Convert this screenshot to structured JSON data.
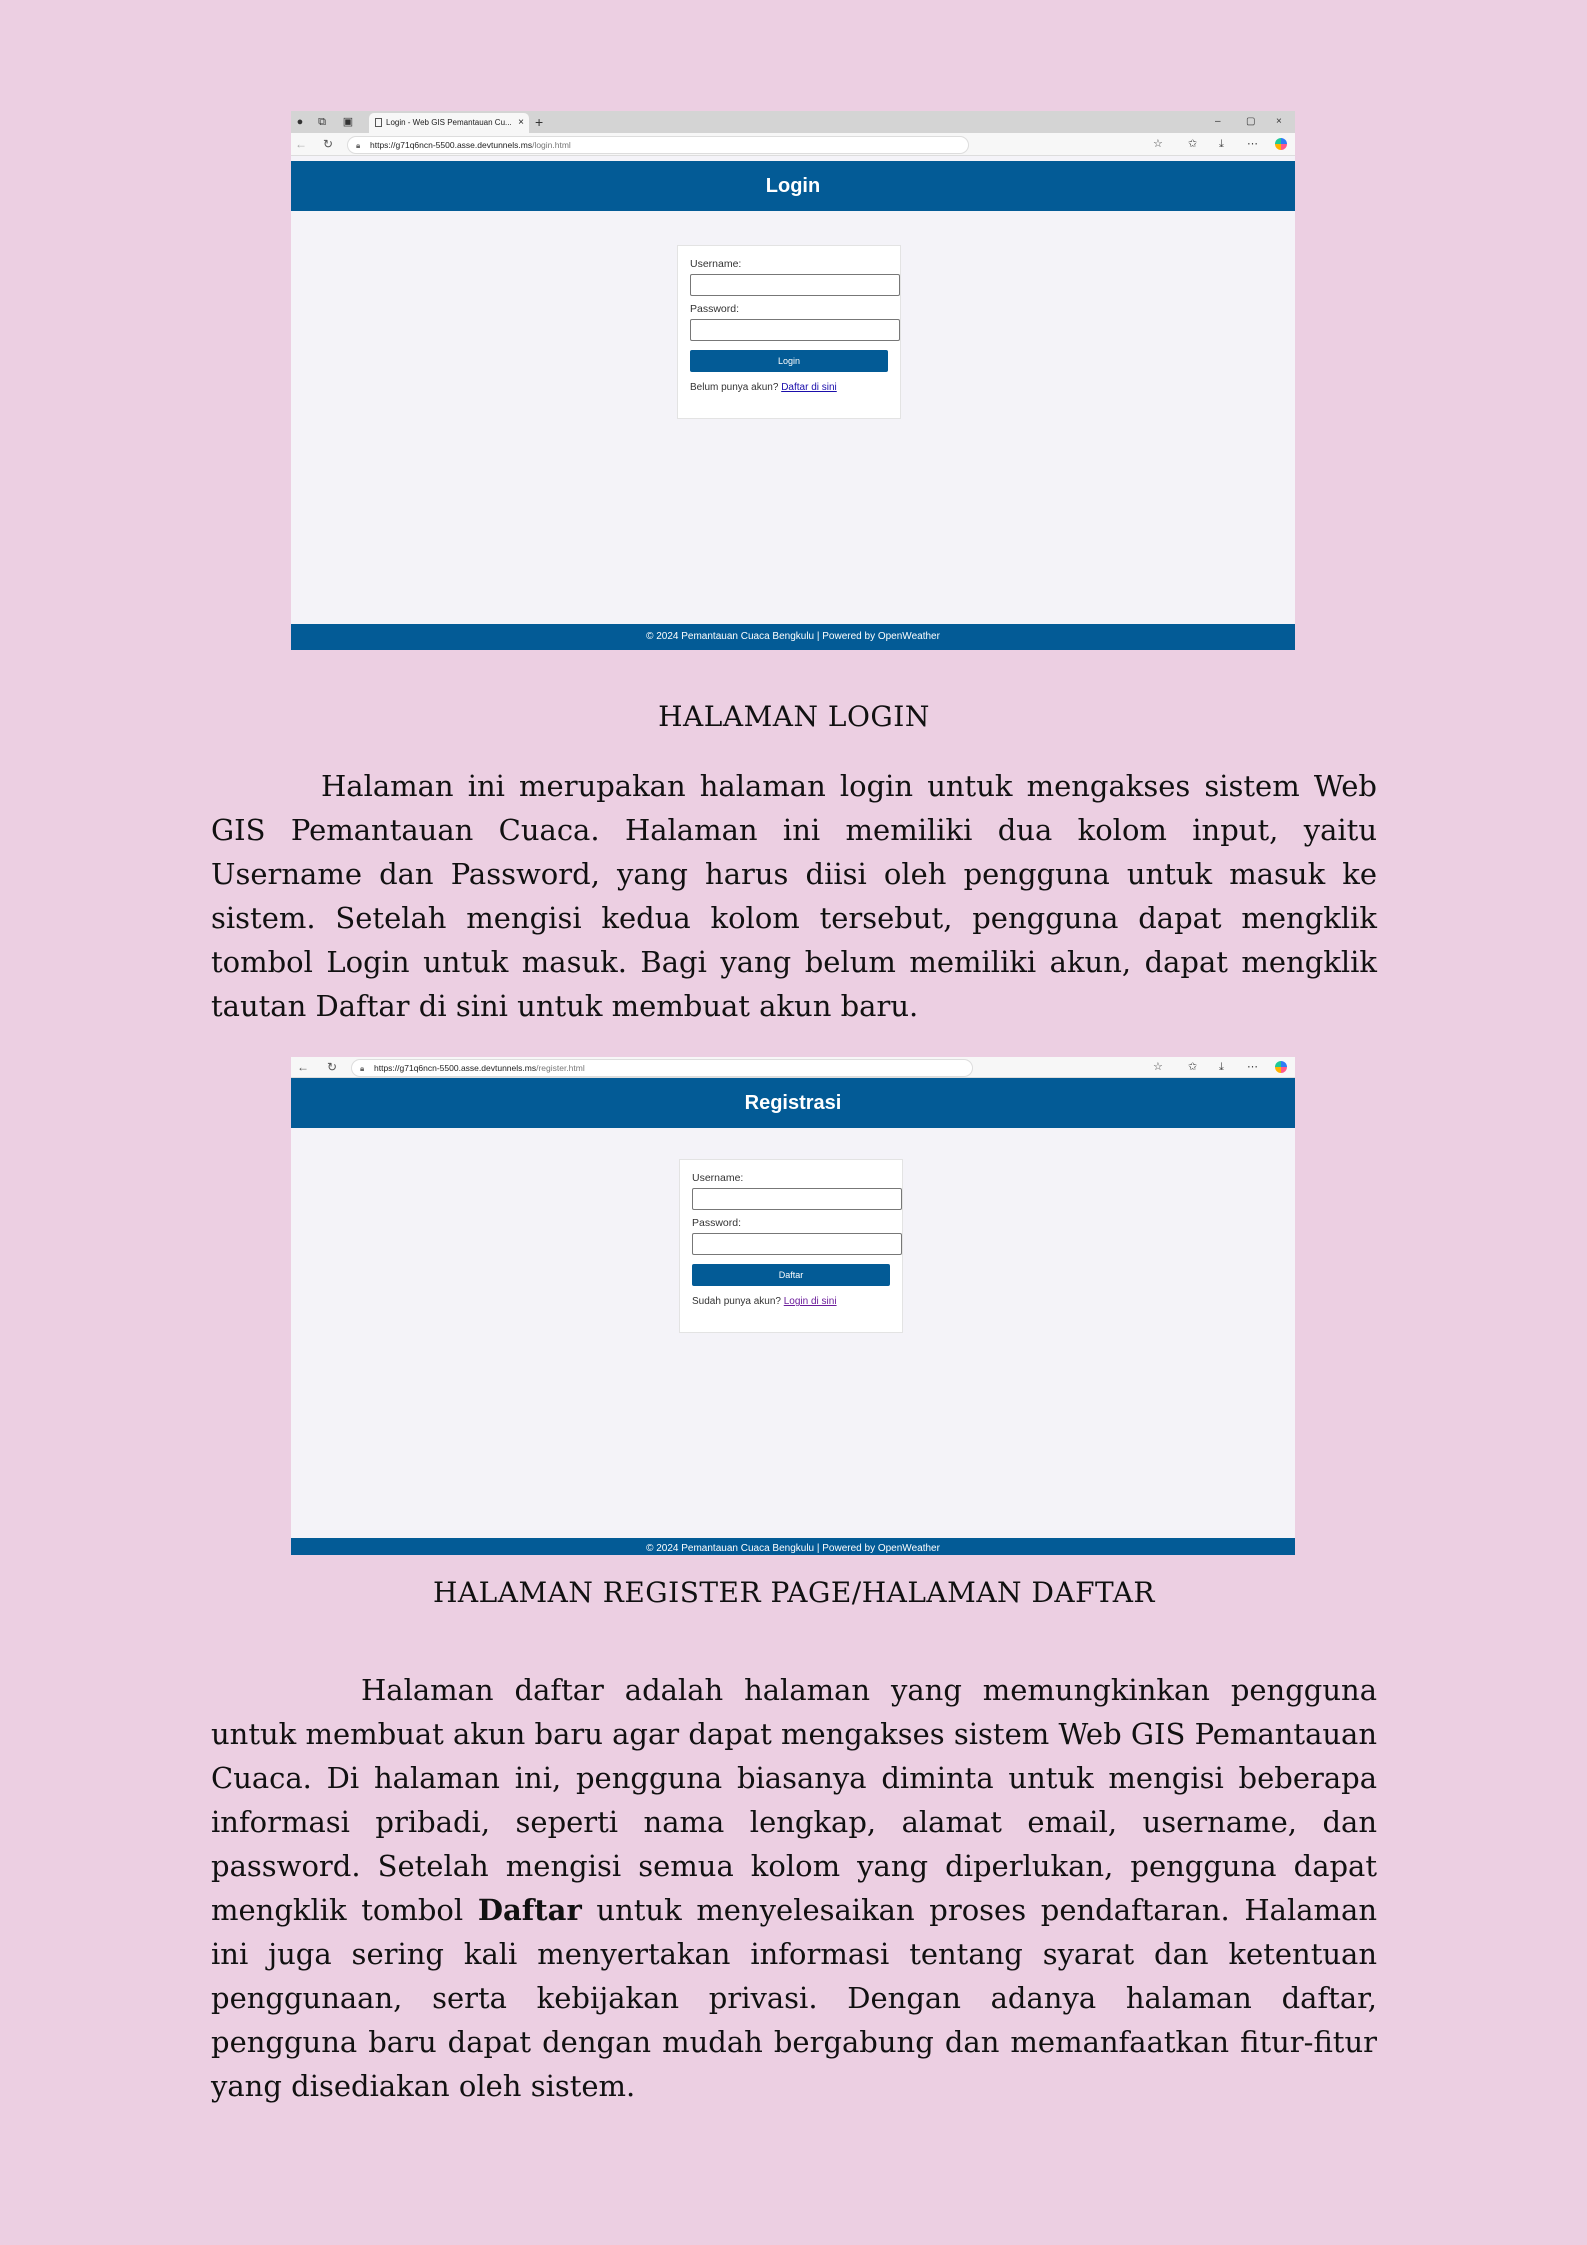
{
  "login_screenshot": {
    "tab_title": "Login - Web GIS Pemantauan Cu...",
    "tab_close": "×",
    "new_tab": "+",
    "window_controls": [
      "–",
      "▢",
      "×"
    ],
    "url_host": "https://g71q6ncn-5500.asse.devtunnels.ms",
    "url_path": "/login.html",
    "header_title": "Login",
    "username_label": "Username:",
    "password_label": "Password:",
    "button_label": "Login",
    "prompt_text": "Belum punya akun?",
    "link_text": "Daftar di sini",
    "footer_text": "© 2024 Pemantauan Cuaca Bengkulu | Powered by OpenWeather"
  },
  "caption_login": "HALAMAN LOGIN",
  "paragraph_login": "Halaman ini merupakan halaman login untuk mengakses sistem Web GIS Pemantauan Cuaca. Halaman ini memiliki dua kolom input, yaitu Username dan Password, yang harus diisi oleh pengguna untuk masuk ke sistem. Setelah mengisi kedua kolom tersebut, pengguna dapat mengklik tombol Login untuk masuk. Bagi yang belum memiliki akun, dapat mengklik tautan Daftar di sini untuk membuat akun baru.",
  "register_screenshot": {
    "url_host": "https://g71q6ncn-5500.asse.devtunnels.ms",
    "url_path": "/register.html",
    "header_title": "Registrasi",
    "username_label": "Username:",
    "password_label": "Password:",
    "button_label": "Daftar",
    "prompt_text": "Sudah punya akun?",
    "link_text": "Login di sini",
    "footer_text": "© 2024 Pemantauan Cuaca Bengkulu | Powered by OpenWeather"
  },
  "caption_register": "HALAMAN REGISTER PAGE/HALAMAN DAFTAR",
  "paragraph_register": {
    "before": "Halaman daftar adalah halaman yang memungkinkan pengguna untuk membuat akun baru agar dapat mengakses sistem Web GIS Pemantauan Cuaca. Di halaman ini, pengguna biasanya diminta untuk mengisi beberapa informasi pribadi, seperti nama lengkap, alamat email, username, dan password. Setelah mengisi semua kolom yang diperlukan, pengguna dapat mengklik tombol ",
    "bold": "Daftar",
    "after": " untuk menyelesaikan proses pendaftaran. Halaman ini juga sering kali menyertakan informasi tentang syarat dan ketentuan penggunaan, serta kebijakan privasi. Dengan adanya halaman daftar, pengguna baru dapat dengan mudah bergabung dan memanfaatkan fitur-fitur yang disediakan oleh sistem."
  }
}
